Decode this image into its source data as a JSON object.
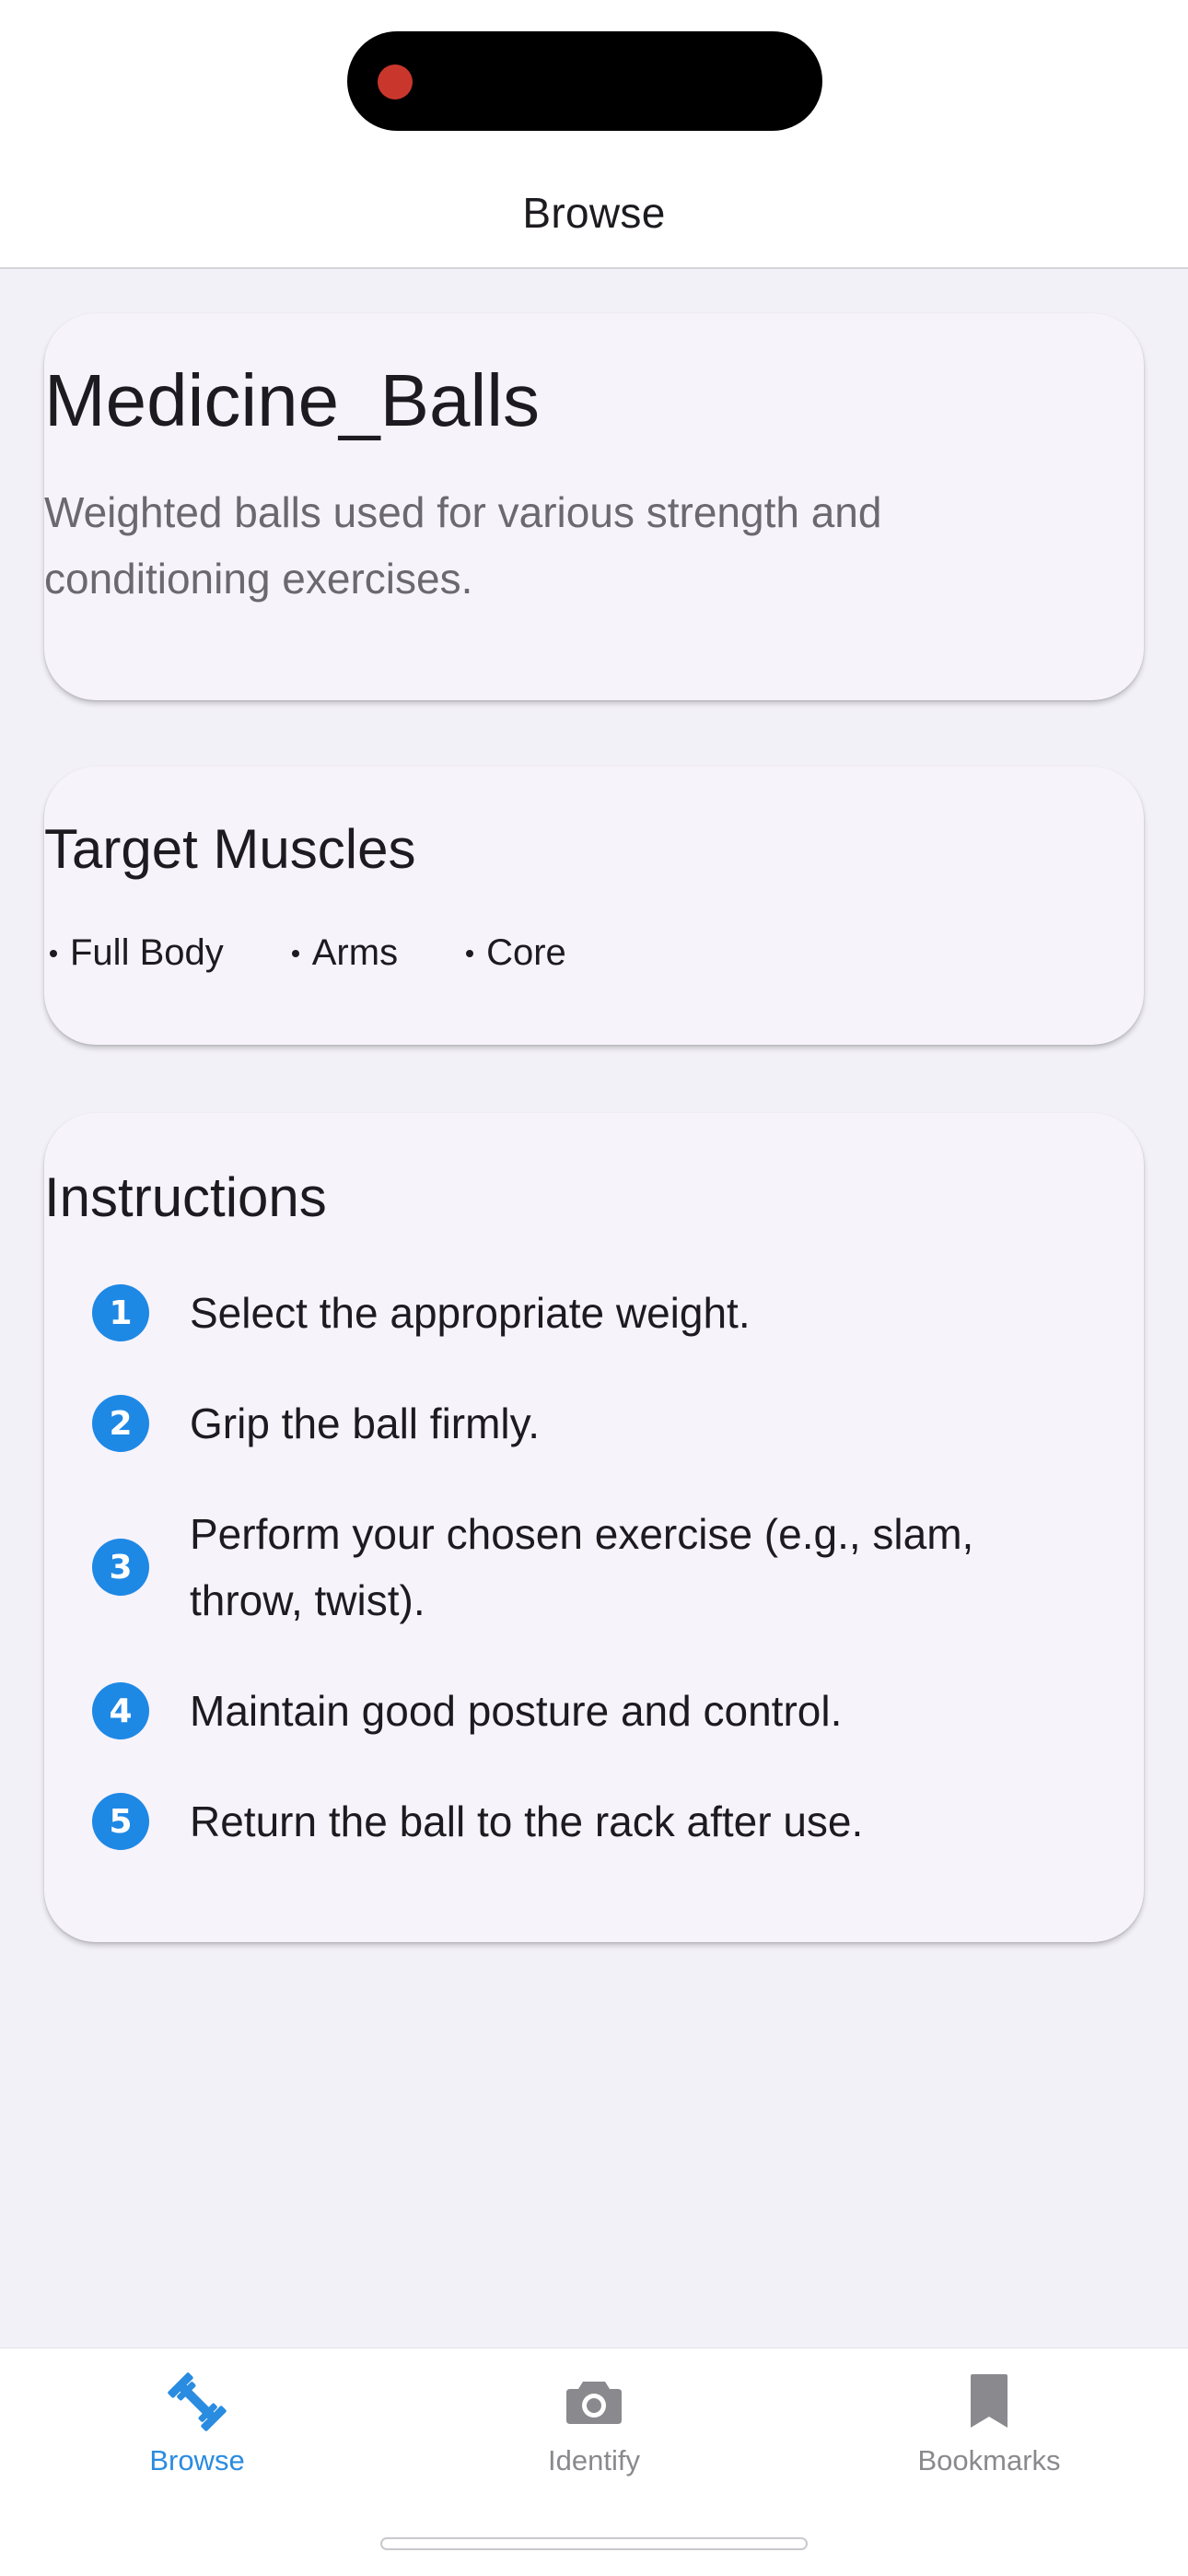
{
  "nav": {
    "title": "Browse"
  },
  "exercise": {
    "name": "Medicine_Balls",
    "description": "Weighted balls used for various strength and conditioning exercises."
  },
  "muscles": {
    "title": "Target Muscles",
    "items": [
      "Full Body",
      "Arms",
      "Core"
    ]
  },
  "instructions": {
    "title": "Instructions",
    "steps": [
      {
        "number": "1",
        "text": "Select the appropriate weight."
      },
      {
        "number": "2",
        "text": "Grip the ball firmly."
      },
      {
        "number": "3",
        "text": "Perform your chosen exercise (e.g., slam, throw, twist)."
      },
      {
        "number": "4",
        "text": "Maintain good posture and control."
      },
      {
        "number": "5",
        "text": "Return the ball to the rack after use."
      }
    ]
  },
  "tabs": [
    {
      "label": "Browse",
      "icon": "dumbbell-icon",
      "active": true
    },
    {
      "label": "Identify",
      "icon": "camera-icon",
      "active": false
    },
    {
      "label": "Bookmarks",
      "icon": "bookmark-icon",
      "active": false
    }
  ],
  "colors": {
    "accent": "#2a8ce0",
    "step_badge": "#1e88e5",
    "recording_dot": "#c9372c",
    "inactive_tab": "#8a8a8e",
    "card_background": "#f7f3fa",
    "page_background": "#f2f1f7"
  }
}
